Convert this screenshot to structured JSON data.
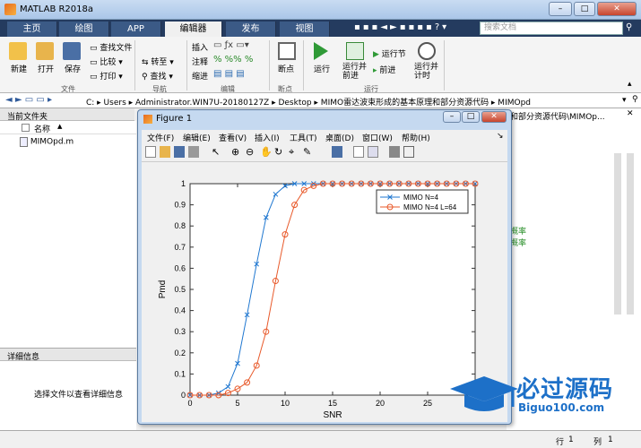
{
  "window": {
    "title": "MATLAB R2018a"
  },
  "tabs": [
    "主页",
    "绘图",
    "APP",
    "编辑器",
    "发布",
    "视图"
  ],
  "search": {
    "placeholder": "搜索文档"
  },
  "ribbon": {
    "new": "新建",
    "open": "打开",
    "save": "保存",
    "find_files": "查找文件",
    "compare": "比较",
    "print": "打印",
    "group_file": "文件",
    "goto": "转至",
    "find": "查找",
    "group_nav": "导航",
    "insert": "插入",
    "comment": "注释",
    "indent": "缩进",
    "group_edit": "编辑",
    "breakpoints": "断点",
    "group_breakpoints": "断点",
    "run": "运行",
    "run_advance": "运行并\n前进",
    "run_section": "运行节",
    "advance": "前进",
    "run_time": "运行并\n计时",
    "group_run": "运行"
  },
  "address": {
    "path": "C: ▸ Users ▸ Administrator.WIN7U-20180127Z ▸ Desktop ▸ MIMO雷达波束形成的基本原理和部分资源代码 ▸ MIMOpd",
    "overflow": "和部分资源代码\\MIMOp..."
  },
  "current_folder": {
    "header": "当前文件夹",
    "col_name": "名称",
    "sort": "▲",
    "files": [
      "MIMOpd.m"
    ]
  },
  "details": {
    "header": "详细信息",
    "message": "选择文件以查看详细信息"
  },
  "editor_text": [
    "概率",
    "概率"
  ],
  "status": {
    "row_label": "行",
    "row": "1",
    "col_label": "列",
    "col": "1"
  },
  "figure": {
    "title": "Figure 1",
    "menu": [
      "文件(F)",
      "编辑(E)",
      "查看(V)",
      "插入(I)",
      "工具(T)",
      "桌面(D)",
      "窗口(W)",
      "帮助(H)"
    ]
  },
  "watermark": {
    "text": "必过源码",
    "url": "Biguo100.com"
  },
  "chart_data": {
    "type": "line",
    "xlabel": "SNR",
    "ylabel": "Pmd",
    "xlim": [
      0,
      30
    ],
    "ylim": [
      0,
      1
    ],
    "xticks": [
      0,
      5,
      10,
      15,
      20,
      25
    ],
    "yticks": [
      0,
      0.1,
      0.2,
      0.3,
      0.4,
      0.5,
      0.6,
      0.7,
      0.8,
      0.9,
      1
    ],
    "legend_position": "top-right",
    "series": [
      {
        "name": "MIMO N=4",
        "color": "#1f77d0",
        "marker": "x",
        "x": [
          0,
          1,
          2,
          3,
          4,
          5,
          6,
          7,
          8,
          9,
          10,
          11,
          12,
          13,
          14,
          15,
          16,
          17,
          18,
          19,
          20,
          21,
          22,
          23,
          24,
          25,
          26,
          27,
          28,
          29,
          30
        ],
        "y": [
          0,
          0,
          0,
          0.01,
          0.04,
          0.15,
          0.38,
          0.62,
          0.84,
          0.95,
          0.99,
          1,
          1,
          1,
          1,
          1,
          1,
          1,
          1,
          1,
          1,
          1,
          1,
          1,
          1,
          1,
          1,
          1,
          1,
          1,
          1
        ]
      },
      {
        "name": "MIMO N=4 L=64",
        "color": "#e8592a",
        "marker": "o",
        "x": [
          0,
          1,
          2,
          3,
          4,
          5,
          6,
          7,
          8,
          9,
          10,
          11,
          12,
          13,
          14,
          15,
          16,
          17,
          18,
          19,
          20,
          21,
          22,
          23,
          24,
          25,
          26,
          27,
          28,
          29,
          30
        ],
        "y": [
          0,
          0,
          0,
          0,
          0.01,
          0.03,
          0.06,
          0.14,
          0.3,
          0.54,
          0.76,
          0.9,
          0.97,
          0.99,
          1,
          1,
          1,
          1,
          1,
          1,
          1,
          1,
          1,
          1,
          1,
          1,
          1,
          1,
          1,
          1,
          1
        ]
      }
    ]
  }
}
